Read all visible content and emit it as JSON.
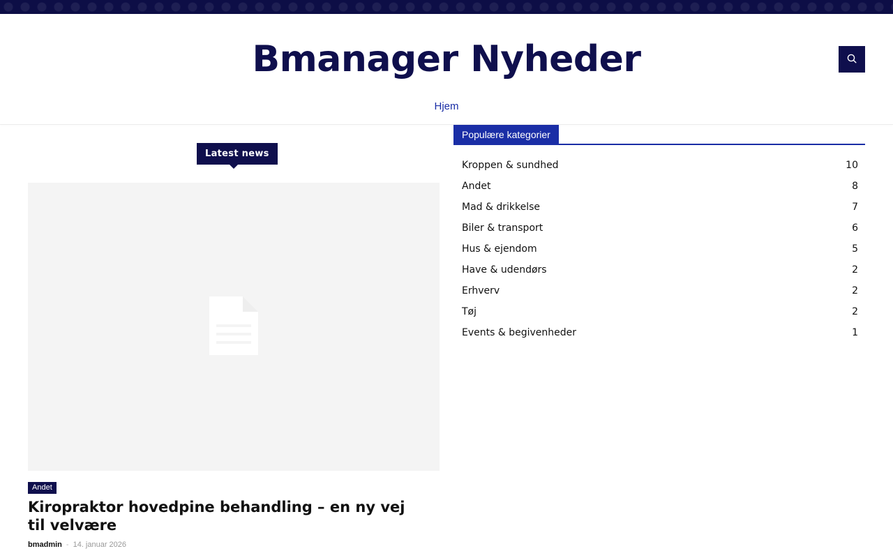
{
  "header": {
    "site_title": "Bmanager Nyheder",
    "search_icon": "search-icon"
  },
  "nav": {
    "items": [
      {
        "label": "Hjem"
      }
    ]
  },
  "main": {
    "section_badge": "Latest news",
    "post": {
      "image_icon": "document-placeholder-icon",
      "category": "Andet",
      "title": "Kiropraktor hovedpine behandling – en ny vej til velvære",
      "author": "bmadmin",
      "separator": "-",
      "date": "14. januar 2026"
    }
  },
  "sidebar": {
    "widget_title": "Populære kategorier",
    "categories": [
      {
        "name": "Kroppen & sundhed",
        "count": "10"
      },
      {
        "name": "Andet",
        "count": "8"
      },
      {
        "name": "Mad & drikkelse",
        "count": "7"
      },
      {
        "name": "Biler & transport",
        "count": "6"
      },
      {
        "name": "Hus & ejendom",
        "count": "5"
      },
      {
        "name": "Have & udendørs",
        "count": "2"
      },
      {
        "name": "Erhverv",
        "count": "2"
      },
      {
        "name": "Tøj",
        "count": "2"
      },
      {
        "name": "Events & begivenheder",
        "count": "1"
      }
    ]
  },
  "colors": {
    "brand_dark": "#0f0f4d",
    "accent_blue": "#1a2ea6",
    "placeholder_bg": "#f4f4f4"
  }
}
